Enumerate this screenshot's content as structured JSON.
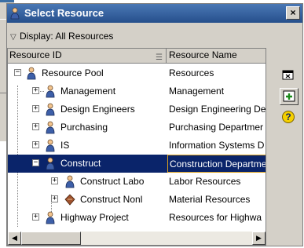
{
  "dialog": {
    "title": "Select Resource",
    "close_label": "×"
  },
  "display": {
    "label": "Display: All Resources"
  },
  "columns": {
    "resource_id": "Resource ID",
    "resource_name": "Resource Name"
  },
  "rows": [
    {
      "id": "Resource Pool",
      "name": "Resources",
      "expander": "−"
    },
    {
      "id": "Management",
      "name": "Management",
      "expander": "+"
    },
    {
      "id": "Design Engineers",
      "name": "Design Engineering De",
      "expander": "+"
    },
    {
      "id": "Purchasing",
      "name": "Purchasing Departmer",
      "expander": "+"
    },
    {
      "id": "IS",
      "name": "Information Systems D",
      "expander": "+"
    },
    {
      "id": "Construct",
      "name": "Construction Departme",
      "expander": "−"
    },
    {
      "id": "Construct Labo",
      "name": "Labor Resources",
      "expander": "+"
    },
    {
      "id": "Construct Nonl",
      "name": "Material Resources",
      "expander": "+"
    },
    {
      "id": "Highway Project",
      "name": "Resources for Highwa",
      "expander": "+"
    }
  ],
  "scroll": {
    "left_arrow": "◀",
    "right_arrow": "▶"
  },
  "side_tools": {
    "help_glyph": "?"
  },
  "colors": {
    "selection": "#0a246a",
    "titlebar": "#264f8c",
    "accent_border": "#d9a020"
  }
}
